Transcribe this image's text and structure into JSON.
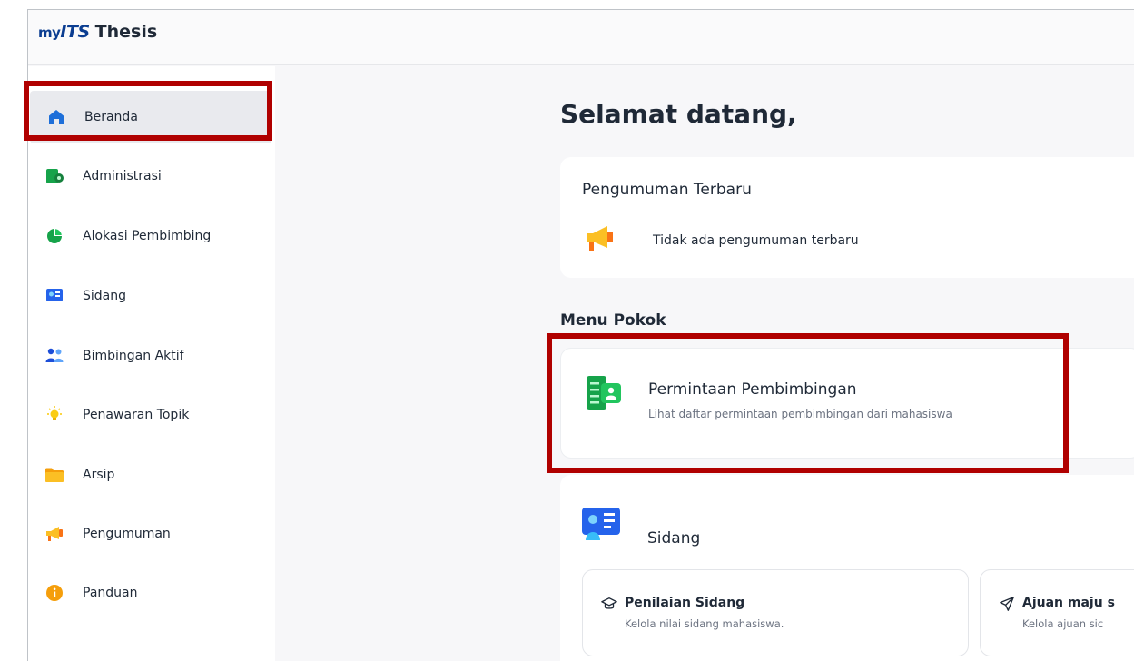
{
  "brand": {
    "logo_prefix": "my",
    "logo_its": "ITS",
    "title": "Thesis"
  },
  "sidebar": {
    "items": [
      {
        "label": "Beranda",
        "icon": "home-icon",
        "active": true
      },
      {
        "label": "Administrasi",
        "icon": "admin-icon"
      },
      {
        "label": "Alokasi Pembimbing",
        "icon": "pie-chart-icon"
      },
      {
        "label": "Sidang",
        "icon": "id-card-icon"
      },
      {
        "label": "Bimbingan Aktif",
        "icon": "people-icon"
      },
      {
        "label": "Penawaran Topik",
        "icon": "lightbulb-icon"
      },
      {
        "label": "Arsip",
        "icon": "folder-icon"
      },
      {
        "label": "Pengumuman",
        "icon": "megaphone-icon"
      },
      {
        "label": "Panduan",
        "icon": "info-icon"
      }
    ]
  },
  "main": {
    "welcome": "Selamat datang,",
    "announcements": {
      "title": "Pengumuman Terbaru",
      "empty_text": "Tidak ada pengumuman terbaru"
    },
    "menu_heading": "Menu Pokok",
    "request_card": {
      "title": "Permintaan Pembimbingan",
      "subtitle": "Lihat daftar permintaan pembimbingan dari mahasiswa"
    },
    "sidang_card": {
      "title": "Sidang",
      "items": [
        {
          "title": "Penilaian Sidang",
          "desc": "Kelola nilai sidang mahasiswa."
        },
        {
          "title": "Ajuan maju s",
          "desc": "Kelola ajuan sic"
        }
      ]
    }
  },
  "colors": {
    "brand": "#0b3d91",
    "highlight": "#b00000",
    "accent_green": "#16a34a",
    "accent_blue": "#2563eb"
  }
}
